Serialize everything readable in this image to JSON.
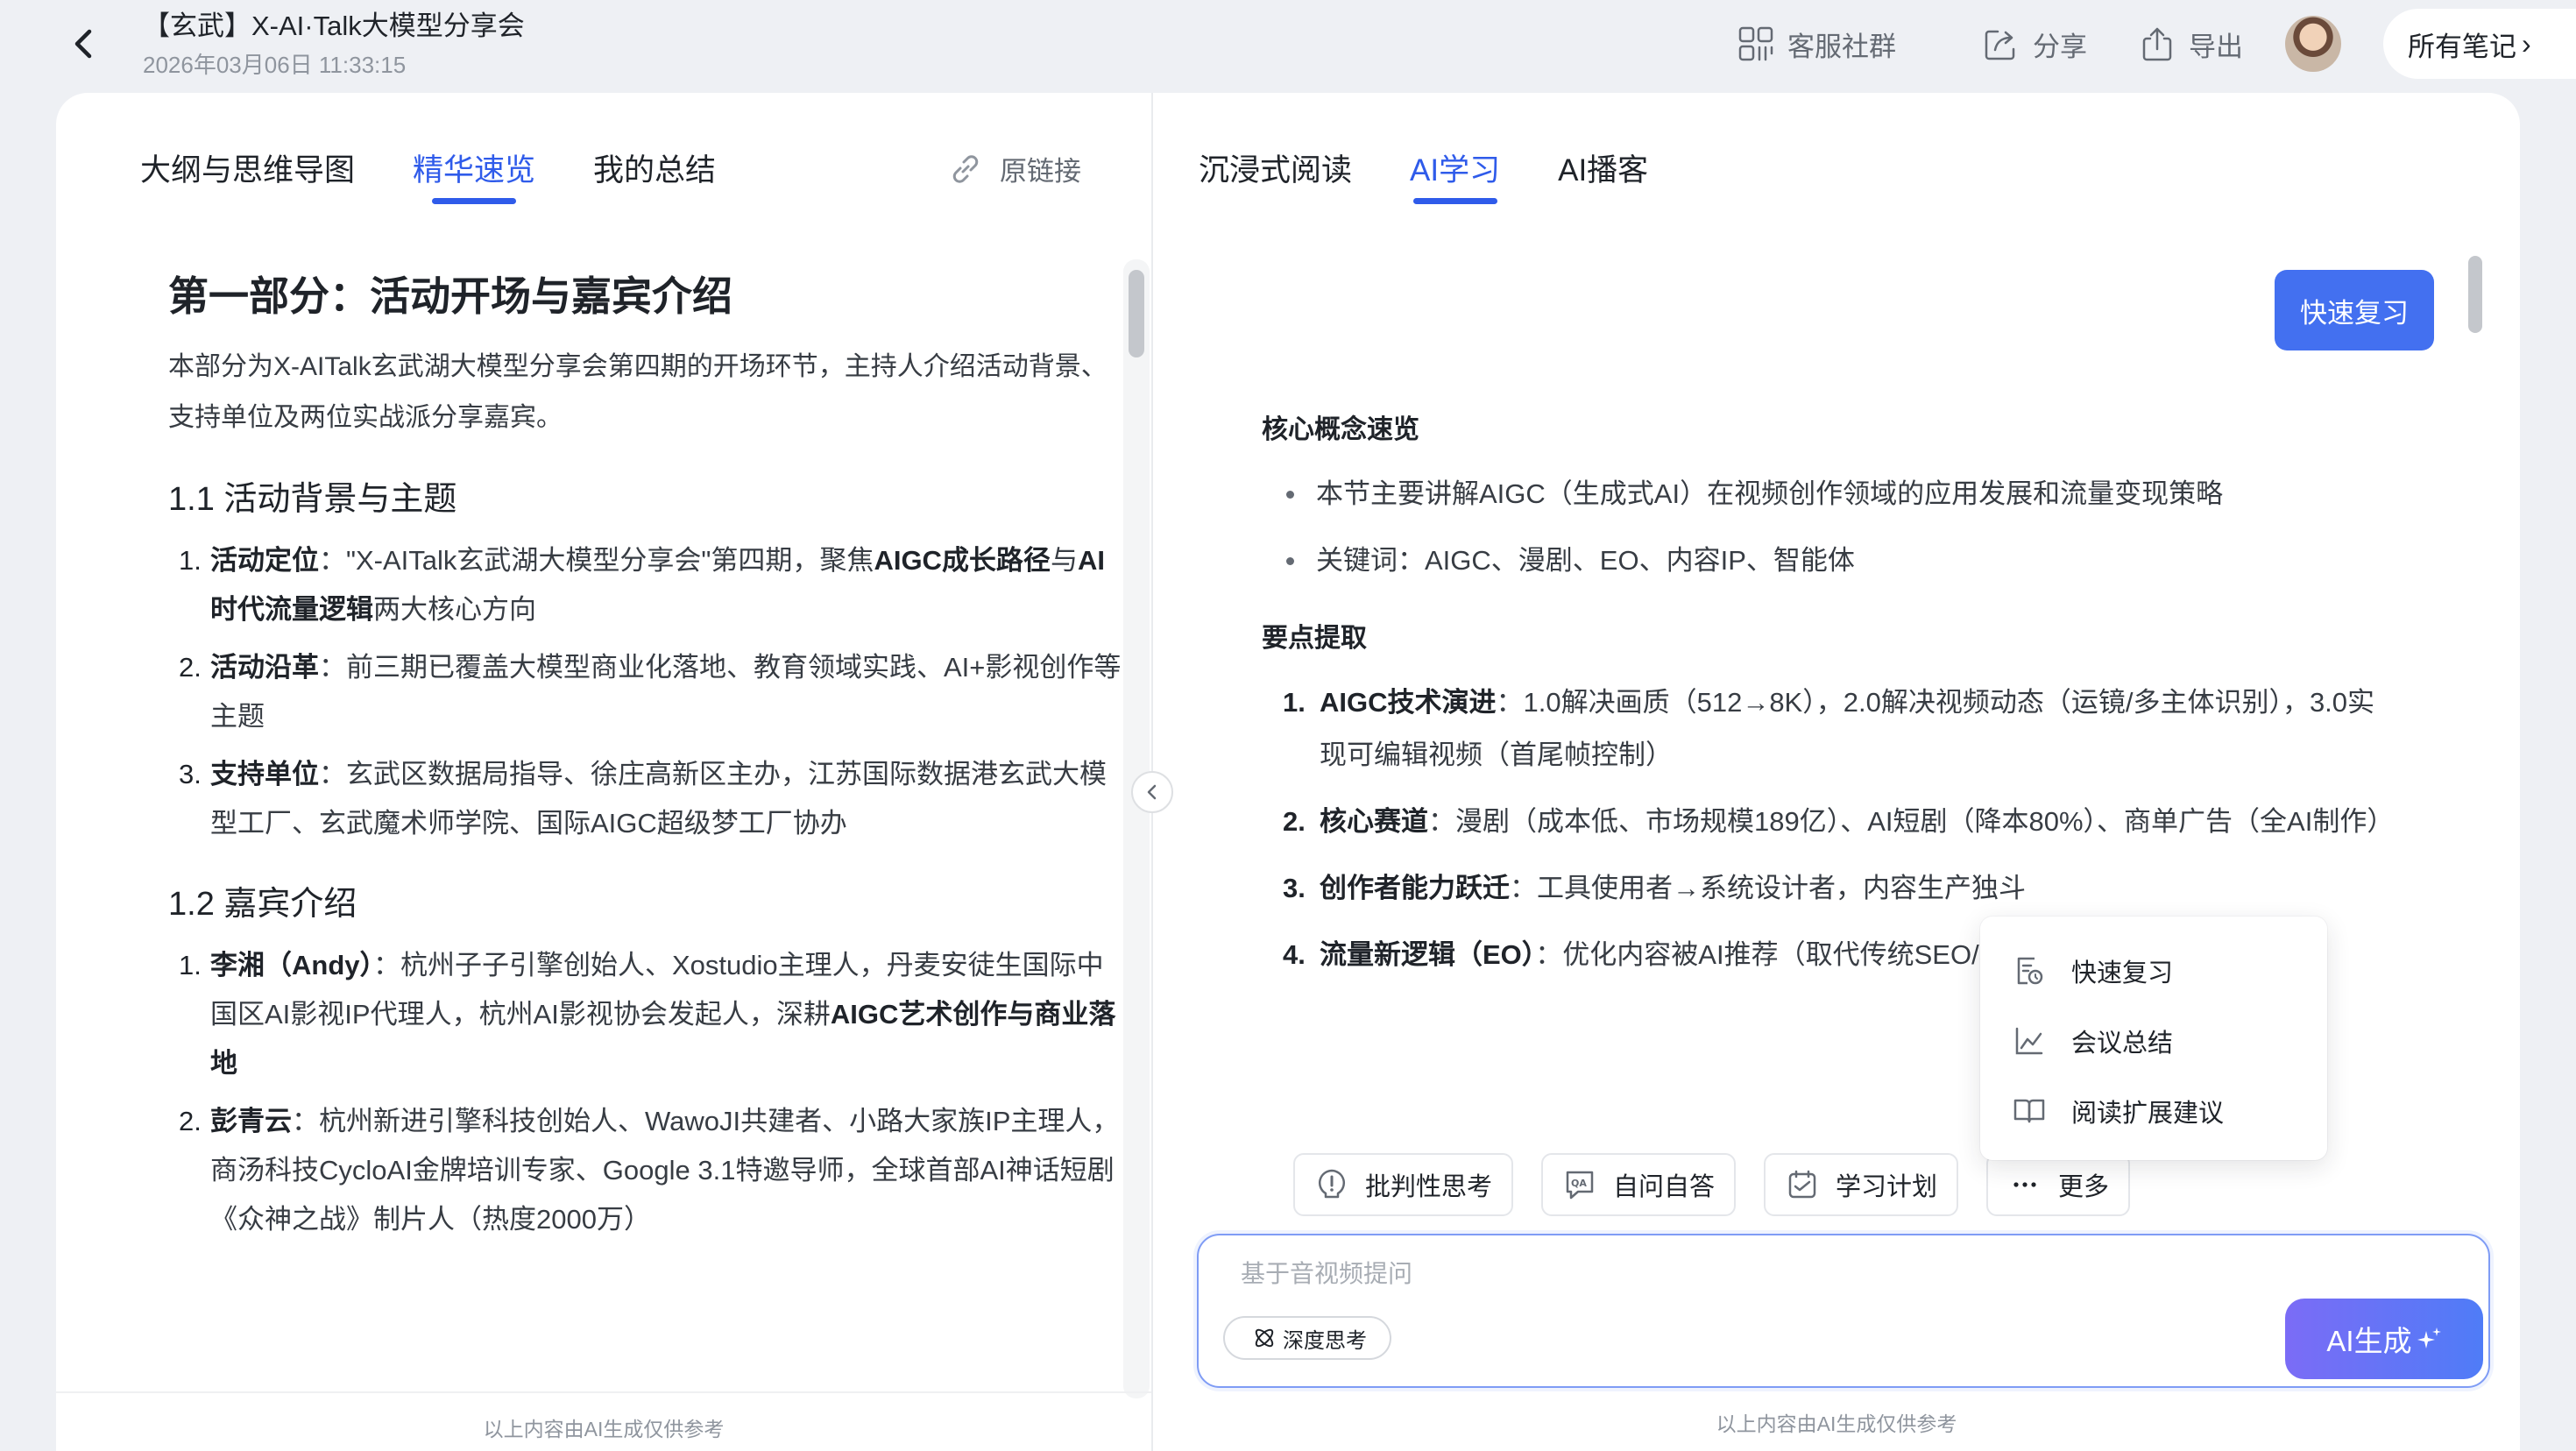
{
  "header": {
    "title": "【玄武】X-AI·Talk大模型分享会",
    "datetime": "2026年03月06日 11:33:15",
    "actions": {
      "service": "客服社群",
      "share": "分享",
      "export": "导出"
    },
    "all_notes": "所有笔记"
  },
  "left_panel": {
    "tabs": [
      "大纲与思维导图",
      "精华速览",
      "我的总结"
    ],
    "active_tab": "精华速览",
    "source_link": "原链接",
    "section_title": "第一部分：活动开场与嘉宾介绍",
    "intro": "本部分为X-AITalk玄武湖大模型分享会第四期的开场环节，主持人介绍活动背景、支持单位及两位实战派分享嘉宾。",
    "sub1": {
      "title": "1.1 活动背景与主题",
      "items": [
        {
          "num": "1.",
          "parts": [
            {
              "b": "活动定位"
            },
            {
              "t": "：\"X-AITalk玄武湖大模型分享会\"第四期，聚焦"
            },
            {
              "b": "AIGC成长路径"
            },
            {
              "t": "与"
            },
            {
              "b": "AI时代流量逻辑"
            },
            {
              "t": "两大核心方向"
            }
          ]
        },
        {
          "num": "2.",
          "parts": [
            {
              "b": "活动沿革"
            },
            {
              "t": "：前三期已覆盖大模型商业化落地、教育领域实践、AI+影视创作等主题"
            }
          ]
        },
        {
          "num": "3.",
          "parts": [
            {
              "b": "支持单位"
            },
            {
              "t": "：玄武区数据局指导、徐庄高新区主办，江苏国际数据港玄武大模型工厂、玄武魔术师学院、国际AIGC超级梦工厂协办"
            }
          ]
        }
      ]
    },
    "sub2": {
      "title": "1.2 嘉宾介绍",
      "items": [
        {
          "num": "1.",
          "parts": [
            {
              "b": "李湘（Andy）"
            },
            {
              "t": "：杭州子子引擎创始人、Xostudio主理人，丹麦安徒生国际中国区AI影视IP代理人，杭州AI影视协会发起人，深耕"
            },
            {
              "b": "AIGC艺术创作与商业落地"
            }
          ]
        },
        {
          "num": "2.",
          "parts": [
            {
              "b": "彭青云"
            },
            {
              "t": "：杭州新进引擎科技创始人、WawoJI共建者、小路大家族IP主理人，商汤科技CycloAI金牌培训专家、Google 3.1特邀导师，全球首部AI神话短剧《众神之战》制片人（热度2000万）"
            }
          ]
        }
      ]
    },
    "footer": "以上内容由AI生成仅供参考"
  },
  "right_panel": {
    "tabs": [
      "沉浸式阅读",
      "AI学习",
      "AI播客"
    ],
    "active_tab": "AI学习",
    "quick_review_button": "快速复习",
    "core_title": "核心概念速览",
    "core_items": [
      "本节主要讲解AIGC（生成式AI）在视频创作领域的应用发展和流量变现策略",
      "关键词：AIGC、漫剧、EO、内容IP、智能体"
    ],
    "points_title": "要点提取",
    "points": [
      {
        "num": "1.",
        "parts": [
          {
            "b": "AIGC技术演进"
          },
          {
            "t": "：1.0解决画质（512→8K），2.0解决视频动态（运镜/多主体识别），3.0实现可编辑视频（首尾帧控制）"
          }
        ]
      },
      {
        "num": "2.",
        "parts": [
          {
            "b": "核心赛道"
          },
          {
            "t": "：漫剧（成本低、市场规模189亿）、AI短剧（降本80%）、商单广告（全AI制作）"
          }
        ]
      },
      {
        "num": "3.",
        "parts": [
          {
            "b": "创作者能力跃迁"
          },
          {
            "t": "：工具使用者→系统设计者，内容生产"
          },
          {
            "t": "独斗"
          }
        ]
      },
      {
        "num": "4.",
        "parts": [
          {
            "b": "流量新逻辑（EO）"
          },
          {
            "t": "：优化内容被AI推荐（取代传统SEO"
          },
          {
            "t": "/表格）"
          }
        ]
      }
    ],
    "chips": [
      "批判性思考",
      "自问自答",
      "学习计划",
      "更多"
    ],
    "more_menu": [
      "快速复习",
      "会议总结",
      "阅读扩展建议"
    ],
    "input_placeholder": "基于音视频提问",
    "deep_think": "深度思考",
    "ai_generate": "AI生成",
    "footer": "以上内容由AI生成仅供参考"
  },
  "colors": {
    "accent": "#2f5bea",
    "button_blue": "#4370f0",
    "gradient_start": "#7b6cf6",
    "gradient_end": "#4f7cf7",
    "text": "#1f2329",
    "muted": "#8f959e"
  },
  "icons": [
    "back-arrow-icon",
    "qr-service-icon",
    "share-icon",
    "export-icon",
    "link-icon",
    "chevron-left-icon",
    "critical-thinking-icon",
    "qa-icon",
    "study-plan-icon",
    "more-dots-icon",
    "review-doc-icon",
    "chart-line-icon",
    "book-icon",
    "deep-think-icon",
    "sparkle-icon"
  ]
}
